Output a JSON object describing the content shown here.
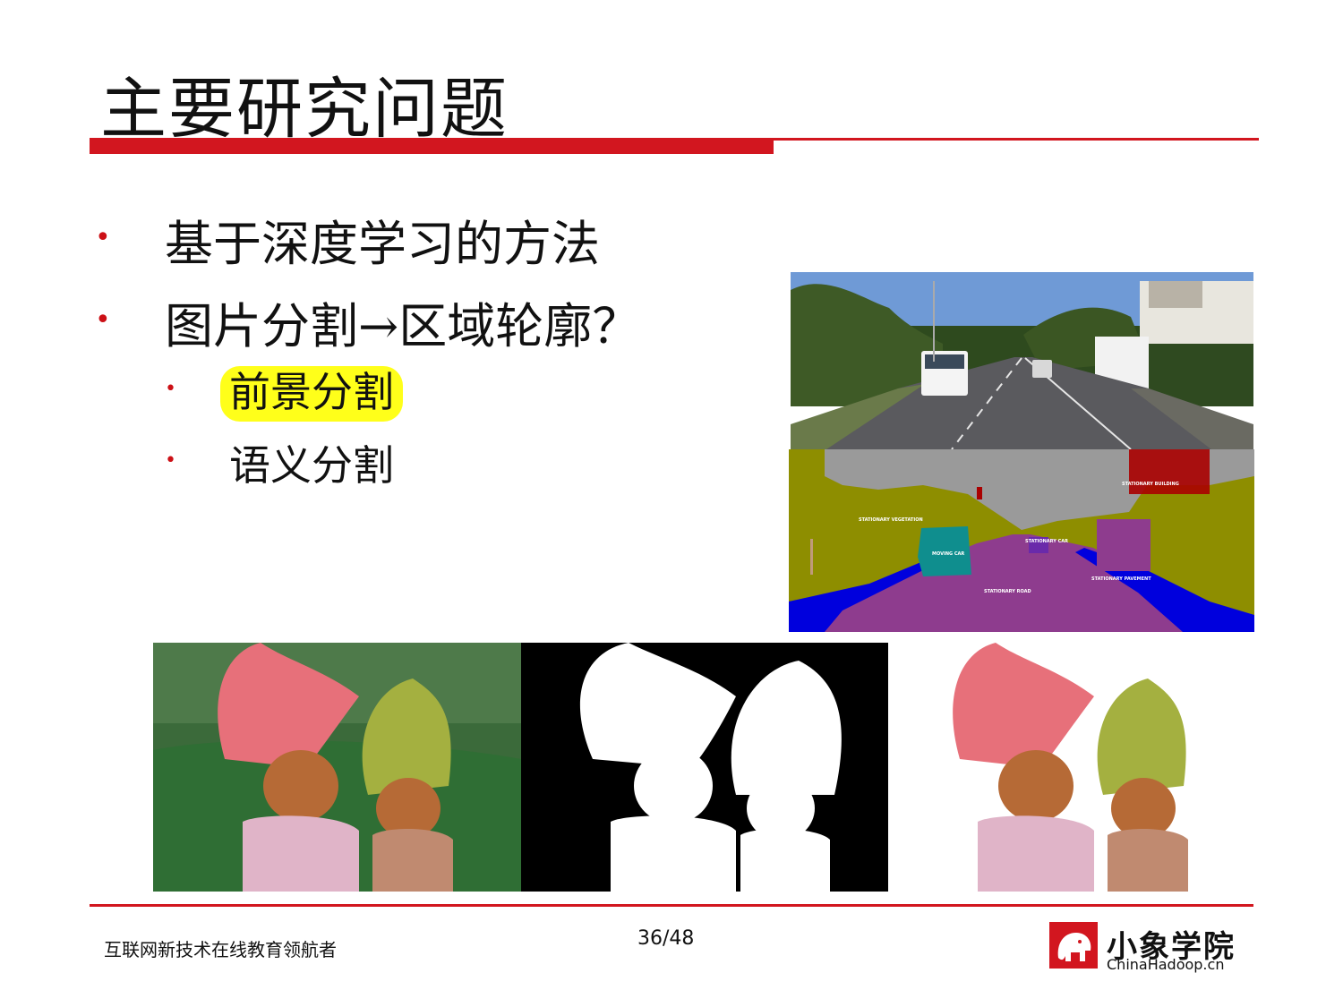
{
  "slide": {
    "title": "主要研究问题",
    "bullets": [
      {
        "text": "基于深度学习的方法",
        "marker": "•"
      },
      {
        "text": "图片分割→区域轮廓？",
        "marker": "•"
      }
    ],
    "sub_bullets": [
      {
        "text": "前景分割",
        "marker": "•",
        "highlighted": true
      },
      {
        "text": "语义分割",
        "marker": "•",
        "highlighted": false
      }
    ]
  },
  "images": {
    "street_photo": {
      "kind": "photo"
    },
    "semantic_map": {
      "labels": {
        "building": "STATIONARY BUILDING",
        "vegetation": "STATIONARY VEGETATION",
        "moving_car": "MOVING CAR",
        "stationary_car": "STATIONARY CAR",
        "pavement": "STATIONARY PAVEMENT",
        "road": "STATIONARY ROAD"
      },
      "colors": {
        "sky": "#9a9a9a",
        "vegetation": "#8e8e00",
        "road": "#8e3c8e",
        "car": "#0f8e8e",
        "pavement": "#0000dd",
        "building": "#aa0000"
      }
    },
    "trolls": [
      "photo",
      "alpha-matte",
      "foreground-cutout"
    ]
  },
  "footer": {
    "motto": "互联网新技术在线教育领航者",
    "page": "36/48",
    "logo_name": "小象学院",
    "logo_url": "ChinaHadoop.cn"
  },
  "colors": {
    "accent": "#d2161f",
    "highlight": "#ffff1a"
  }
}
